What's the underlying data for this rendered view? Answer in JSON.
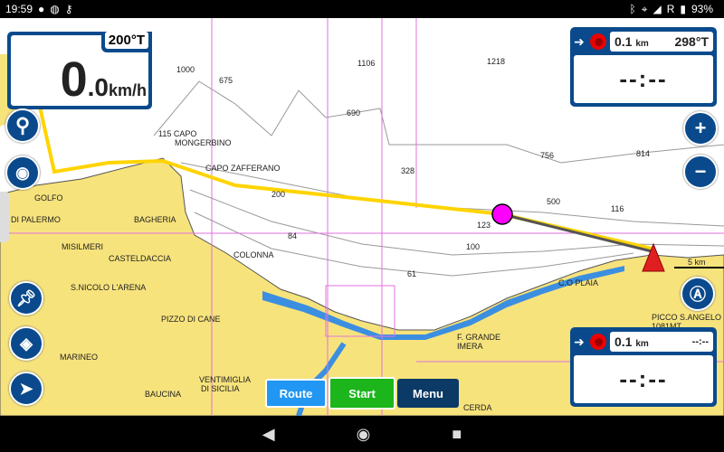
{
  "status_bar": {
    "time": "19:59",
    "battery": "93%",
    "network": "R"
  },
  "speed_panel": {
    "heading": "200°T",
    "speed_int": "0",
    "speed_dec": ".0",
    "speed_unit": "km/h"
  },
  "waypoint_top": {
    "distance": "0.1",
    "distance_unit": "km",
    "bearing": "298°T",
    "eta": "--:--"
  },
  "waypoint_bottom": {
    "distance": "0.1",
    "distance_unit": "km",
    "time": "--:--",
    "eta": "--:--"
  },
  "buttons": {
    "route": "Route",
    "start": "Start",
    "menu": "Menu"
  },
  "scale": "5 km",
  "colors": {
    "panel": "#0a4a8c",
    "land": "#f7e37c",
    "route": "#ffd400",
    "start": "#1cb61c",
    "route_btn": "#2196f3",
    "menu": "#0b3a66"
  },
  "map": {
    "labels": [
      "1000",
      "675",
      "1106",
      "1218",
      "690",
      "115 CAPO",
      "MONGERBINO",
      "CAPO ZAFFERANO",
      "328",
      "756",
      "814",
      "200",
      "500",
      "116",
      "GOLFO",
      "DI PALERMO",
      "BAGHERIA",
      "123",
      "84",
      "100",
      "MISILMERI",
      "CASTELDACCIA",
      "COLONNA",
      "61",
      "C.O PLAIA",
      "S.NICOLO L'ARENA",
      "PIZZO DI CANE",
      "F. GRANDE",
      "IMERA",
      "PICCO S.ANGELO",
      "1081MT",
      "MARINEO",
      "VENTIMIGLIA",
      "DI SICILIA",
      "BAUCINA",
      "CERDA"
    ]
  }
}
